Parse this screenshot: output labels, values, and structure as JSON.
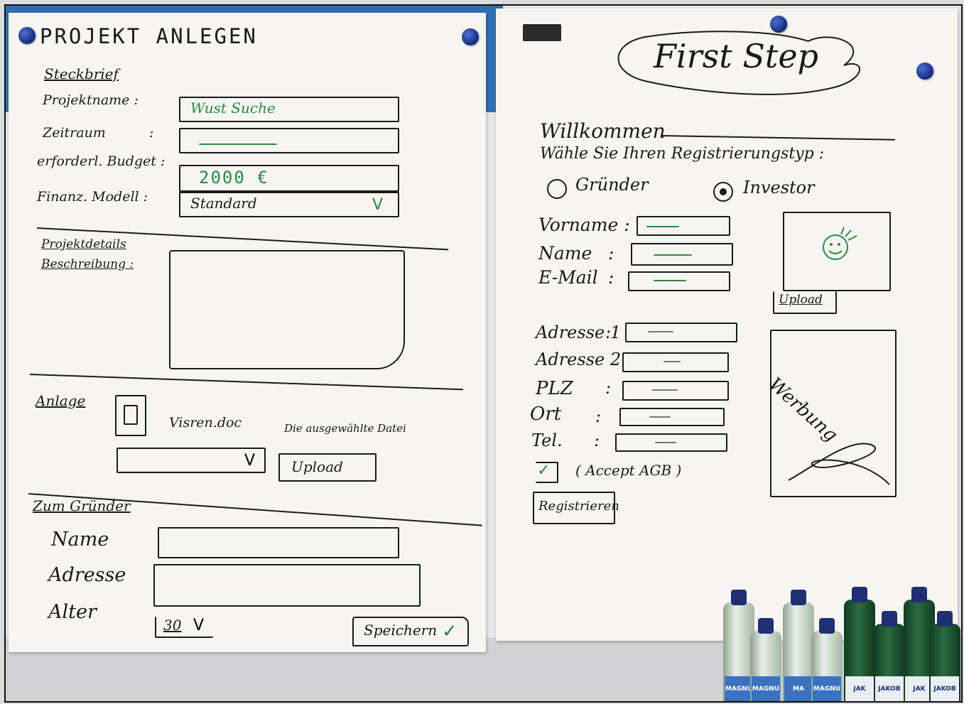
{
  "left_sheet": {
    "title": "PROJEKT ANLEGEN",
    "steckbrief": {
      "section_label": "Steckbrief",
      "projektname_label": "Projektname :",
      "projektname_value": "Wust Suche",
      "zeitraum_label": "Zeitraum",
      "zeitraum_colon": ":",
      "budget_label": "erforderl. Budget :",
      "budget_value": "2000 €",
      "finanz_label": "Finanz. Modell :",
      "finanz_value": "Standard",
      "dropdown_glyph": "V"
    },
    "projektdetails": {
      "section_label": "Projektdetails",
      "beschreibung_label": "Beschreibung :"
    },
    "anlage": {
      "section_label": "Anlage",
      "file_name": "Visren.doc",
      "file_status": "Die ausgewählte Datei",
      "dropdown_glyph": "V",
      "upload_label": "Upload"
    },
    "gruender": {
      "section_label": "Zum Gründer",
      "name_label": "Name",
      "adresse_label": "Adresse",
      "alter_label": "Alter",
      "alter_value": "30",
      "alter_glyph": "V",
      "save_label": "Speichern",
      "save_check": "✓"
    }
  },
  "right_sheet": {
    "title": "First Step",
    "welcome": "Willkommen",
    "prompt": "Wähle Sie Ihren Registrierungstyp :",
    "radio_options": [
      {
        "label": "Gründer",
        "selected": false
      },
      {
        "label": "Investor",
        "selected": true
      }
    ],
    "fields": {
      "vorname_label": "Vorname :",
      "name_label": "Name",
      "email_label": "E-Mail",
      "adresse1_label": "Adresse 1",
      "adresse2_label": "Adresse 2",
      "plz_label": "PLZ",
      "ort_label": "Ort",
      "tel_label": "Tel.",
      "colon": ":"
    },
    "upload_label": "Upload",
    "werbung_label": "Werbung",
    "agb_label": "( Accept AGB )",
    "agb_check": "✓",
    "register_label": "Registrieren"
  },
  "bottles": {
    "brand_a": "MAGNU",
    "brand_b": "JAKOB",
    "brand_c": "MA",
    "brand_d": "JAK"
  },
  "colors": {
    "ink": "#1a1a1a",
    "green_marker": "#2a8a44",
    "board_blue": "#2f6db5",
    "paper": "#f6f5f1"
  }
}
